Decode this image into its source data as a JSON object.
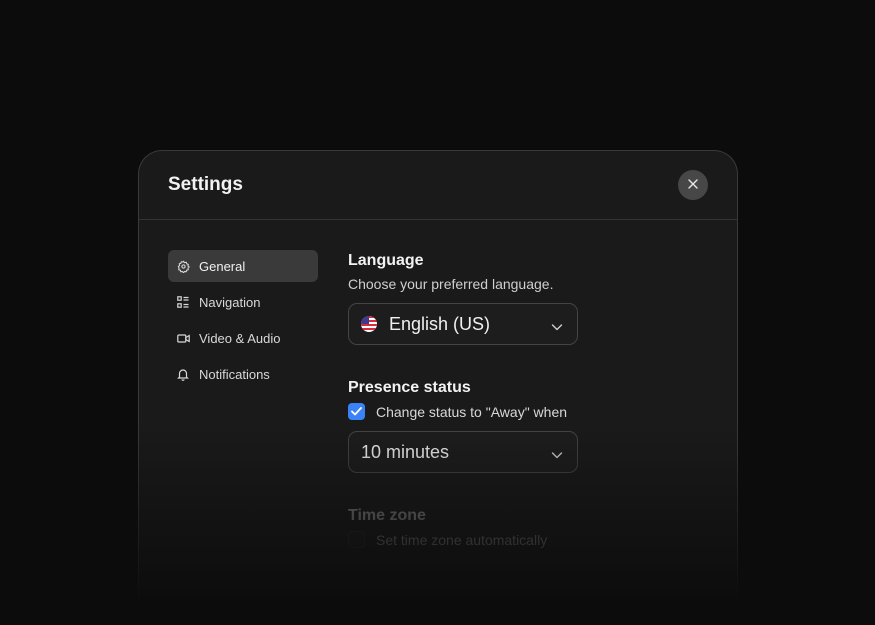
{
  "modal": {
    "title": "Settings",
    "close_icon": "close-icon"
  },
  "sidebar": {
    "items": [
      {
        "label": "General",
        "icon": "gear-icon",
        "active": true
      },
      {
        "label": "Navigation",
        "icon": "list-icon",
        "active": false
      },
      {
        "label": "Video & Audio",
        "icon": "video-camera-icon",
        "active": false
      },
      {
        "label": "Notifications",
        "icon": "bell-icon",
        "active": false
      }
    ]
  },
  "language": {
    "title": "Language",
    "description": "Choose your preferred language.",
    "selected": "English (US)",
    "flag_icon": "us-flag-icon"
  },
  "presence": {
    "title": "Presence status",
    "checkbox_label": "Change status to \"Away\" when",
    "checked": true,
    "selected": "10 minutes"
  },
  "timezone": {
    "title": "Time zone",
    "checkbox_label": "Set time zone automatically",
    "checked": false
  },
  "colors": {
    "accent": "#3b82f6",
    "background": "#0c0c0c",
    "panel": "#1a1a1a"
  }
}
